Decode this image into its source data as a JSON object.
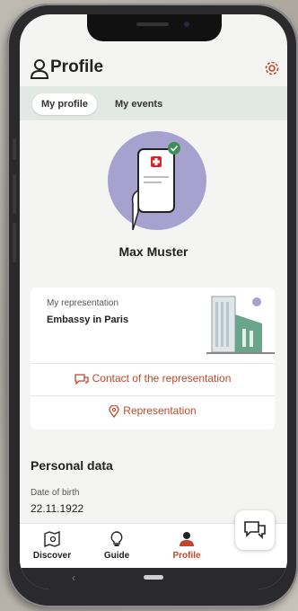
{
  "header": {
    "title": "Profile"
  },
  "tabs": [
    {
      "label": "My profile",
      "active": true
    },
    {
      "label": "My events",
      "active": false
    }
  ],
  "user": {
    "name": "Max Muster"
  },
  "representation": {
    "label": "My representation",
    "value": "Embassy in Paris",
    "contact_link": "Contact of the representation",
    "location_link": "Representation"
  },
  "personal_data": {
    "title": "Personal data",
    "dob_label": "Date of birth",
    "dob_value": "22.11.1922"
  },
  "bottom_nav": [
    {
      "label": "Discover",
      "icon": "map-search-icon"
    },
    {
      "label": "Guide",
      "icon": "lightbulb-icon"
    },
    {
      "label": "Profile",
      "icon": "person-icon",
      "active": true
    }
  ],
  "colors": {
    "accent": "#c4462a",
    "tab_bg": "#e2e8e3",
    "avatar_bg": "#a6a1cf"
  }
}
